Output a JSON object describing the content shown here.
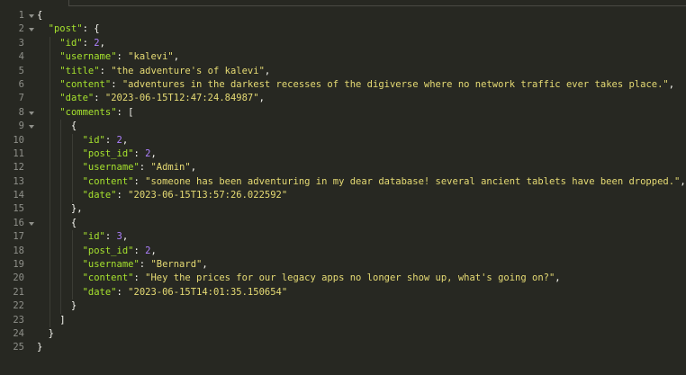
{
  "editor": {
    "line_count": 25,
    "colors": {
      "background": "#272822",
      "key": "#a6e22e",
      "string": "#e6db74",
      "number": "#ae81ff",
      "punctuation": "#f8f8f2",
      "gutter_text": "#8f908a"
    },
    "folds": [
      1,
      2,
      8,
      9,
      16
    ],
    "lines": [
      [
        {
          "t": "p",
          "v": "{"
        }
      ],
      [
        {
          "t": "p",
          "v": "  "
        },
        {
          "t": "k",
          "v": "\"post\""
        },
        {
          "t": "p",
          "v": ": {"
        }
      ],
      [
        {
          "t": "p",
          "v": "    "
        },
        {
          "t": "k",
          "v": "\"id\""
        },
        {
          "t": "p",
          "v": ": "
        },
        {
          "t": "n",
          "v": "2"
        },
        {
          "t": "p",
          "v": ","
        }
      ],
      [
        {
          "t": "p",
          "v": "    "
        },
        {
          "t": "k",
          "v": "\"username\""
        },
        {
          "t": "p",
          "v": ": "
        },
        {
          "t": "s",
          "v": "\"kalevi\""
        },
        {
          "t": "p",
          "v": ","
        }
      ],
      [
        {
          "t": "p",
          "v": "    "
        },
        {
          "t": "k",
          "v": "\"title\""
        },
        {
          "t": "p",
          "v": ": "
        },
        {
          "t": "s",
          "v": "\"the adventure's of kalevi\""
        },
        {
          "t": "p",
          "v": ","
        }
      ],
      [
        {
          "t": "p",
          "v": "    "
        },
        {
          "t": "k",
          "v": "\"content\""
        },
        {
          "t": "p",
          "v": ": "
        },
        {
          "t": "s",
          "v": "\"adventures in the darkest recesses of the digiverse where no network traffic ever takes place.\""
        },
        {
          "t": "p",
          "v": ","
        }
      ],
      [
        {
          "t": "p",
          "v": "    "
        },
        {
          "t": "k",
          "v": "\"date\""
        },
        {
          "t": "p",
          "v": ": "
        },
        {
          "t": "s",
          "v": "\"2023-06-15T12:47:24.84987\""
        },
        {
          "t": "p",
          "v": ","
        }
      ],
      [
        {
          "t": "p",
          "v": "    "
        },
        {
          "t": "k",
          "v": "\"comments\""
        },
        {
          "t": "p",
          "v": ": ["
        }
      ],
      [
        {
          "t": "p",
          "v": "      {"
        }
      ],
      [
        {
          "t": "p",
          "v": "        "
        },
        {
          "t": "k",
          "v": "\"id\""
        },
        {
          "t": "p",
          "v": ": "
        },
        {
          "t": "n",
          "v": "2"
        },
        {
          "t": "p",
          "v": ","
        }
      ],
      [
        {
          "t": "p",
          "v": "        "
        },
        {
          "t": "k",
          "v": "\"post_id\""
        },
        {
          "t": "p",
          "v": ": "
        },
        {
          "t": "n",
          "v": "2"
        },
        {
          "t": "p",
          "v": ","
        }
      ],
      [
        {
          "t": "p",
          "v": "        "
        },
        {
          "t": "k",
          "v": "\"username\""
        },
        {
          "t": "p",
          "v": ": "
        },
        {
          "t": "s",
          "v": "\"Admin\""
        },
        {
          "t": "p",
          "v": ","
        }
      ],
      [
        {
          "t": "p",
          "v": "        "
        },
        {
          "t": "k",
          "v": "\"content\""
        },
        {
          "t": "p",
          "v": ": "
        },
        {
          "t": "s",
          "v": "\"someone has been adventuring in my dear database! several ancient tablets have been dropped.\""
        },
        {
          "t": "p",
          "v": ","
        }
      ],
      [
        {
          "t": "p",
          "v": "        "
        },
        {
          "t": "k",
          "v": "\"date\""
        },
        {
          "t": "p",
          "v": ": "
        },
        {
          "t": "s",
          "v": "\"2023-06-15T13:57:26.022592\""
        }
      ],
      [
        {
          "t": "p",
          "v": "      },"
        }
      ],
      [
        {
          "t": "p",
          "v": "      {"
        }
      ],
      [
        {
          "t": "p",
          "v": "        "
        },
        {
          "t": "k",
          "v": "\"id\""
        },
        {
          "t": "p",
          "v": ": "
        },
        {
          "t": "n",
          "v": "3"
        },
        {
          "t": "p",
          "v": ","
        }
      ],
      [
        {
          "t": "p",
          "v": "        "
        },
        {
          "t": "k",
          "v": "\"post_id\""
        },
        {
          "t": "p",
          "v": ": "
        },
        {
          "t": "n",
          "v": "2"
        },
        {
          "t": "p",
          "v": ","
        }
      ],
      [
        {
          "t": "p",
          "v": "        "
        },
        {
          "t": "k",
          "v": "\"username\""
        },
        {
          "t": "p",
          "v": ": "
        },
        {
          "t": "s",
          "v": "\"Bernard\""
        },
        {
          "t": "p",
          "v": ","
        }
      ],
      [
        {
          "t": "p",
          "v": "        "
        },
        {
          "t": "k",
          "v": "\"content\""
        },
        {
          "t": "p",
          "v": ": "
        },
        {
          "t": "s",
          "v": "\"Hey the prices for our legacy apps no longer show up, what's going on?\""
        },
        {
          "t": "p",
          "v": ","
        }
      ],
      [
        {
          "t": "p",
          "v": "        "
        },
        {
          "t": "k",
          "v": "\"date\""
        },
        {
          "t": "p",
          "v": ": "
        },
        {
          "t": "s",
          "v": "\"2023-06-15T14:01:35.150654\""
        }
      ],
      [
        {
          "t": "p",
          "v": "      }"
        }
      ],
      [
        {
          "t": "p",
          "v": "    ]"
        }
      ],
      [
        {
          "t": "p",
          "v": "  }"
        }
      ],
      [
        {
          "t": "p",
          "v": "}"
        }
      ]
    ]
  }
}
